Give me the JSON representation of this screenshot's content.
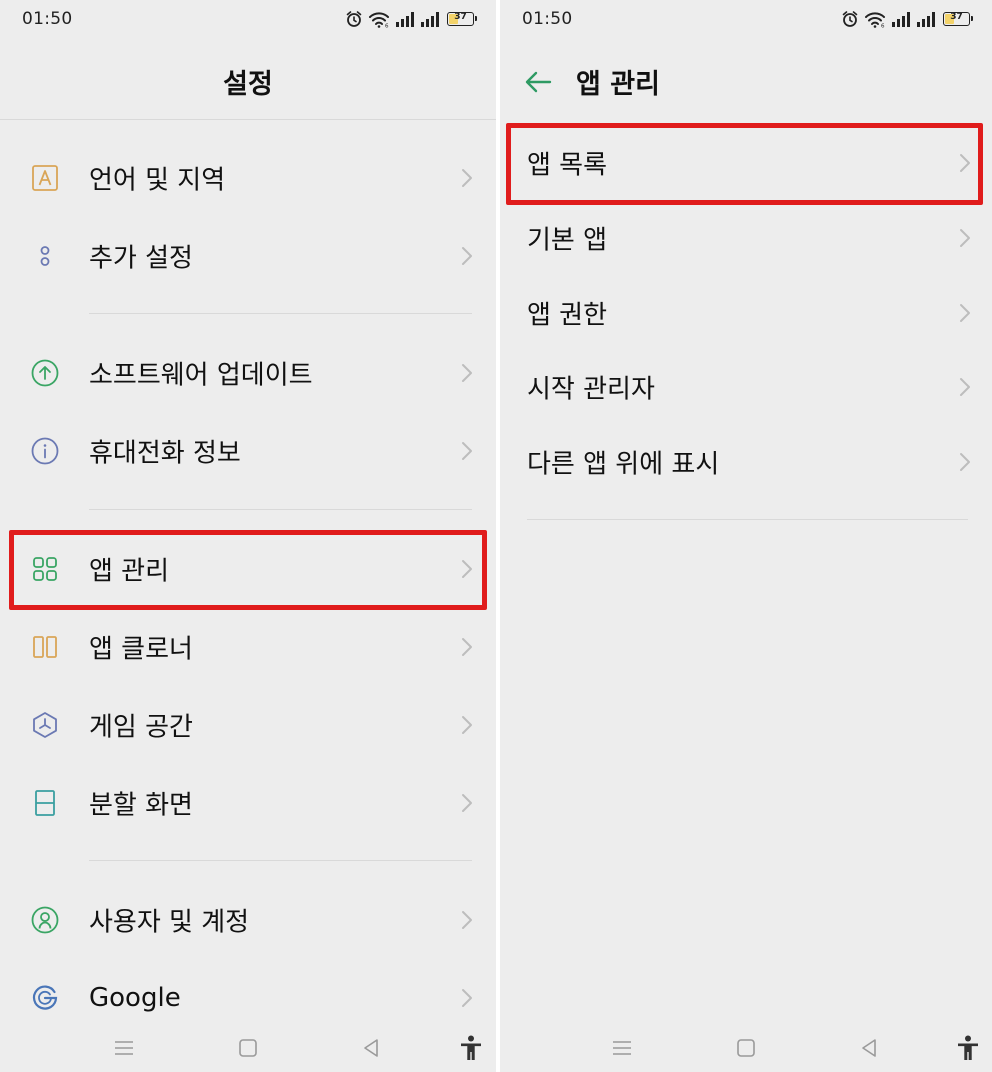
{
  "status_bar": {
    "time": "01:50",
    "battery_level": "37",
    "battery_fill_fraction": 0.37
  },
  "left": {
    "title": "설정",
    "items": [
      {
        "label": "언어 및 지역",
        "icon": "language-icon"
      },
      {
        "label": "추가 설정",
        "icon": "additional-settings-icon"
      },
      {
        "label": "소프트웨어 업데이트",
        "icon": "software-update-icon"
      },
      {
        "label": "휴대전화 정보",
        "icon": "info-icon"
      },
      {
        "label": "앱 관리",
        "icon": "app-grid-icon"
      },
      {
        "label": "앱 클로너",
        "icon": "app-cloner-icon"
      },
      {
        "label": "게임 공간",
        "icon": "game-space-icon"
      },
      {
        "label": "분할 화면",
        "icon": "split-screen-icon"
      },
      {
        "label": "사용자 및 계정",
        "icon": "user-account-icon"
      },
      {
        "label": "Google",
        "icon": "google-icon"
      }
    ]
  },
  "right": {
    "title": "앱 관리",
    "items": [
      {
        "label": "앱 목록"
      },
      {
        "label": "기본 앱"
      },
      {
        "label": "앱 권한"
      },
      {
        "label": "시작 관리자"
      },
      {
        "label": "다른 앱 위에 표시"
      }
    ]
  },
  "colors": {
    "highlight": "#e01c1c",
    "back_arrow": "#2e9a63",
    "background": "#ededed"
  },
  "nav_icons": [
    "menu-icon",
    "home-icon",
    "back-icon",
    "accessibility-icon"
  ]
}
